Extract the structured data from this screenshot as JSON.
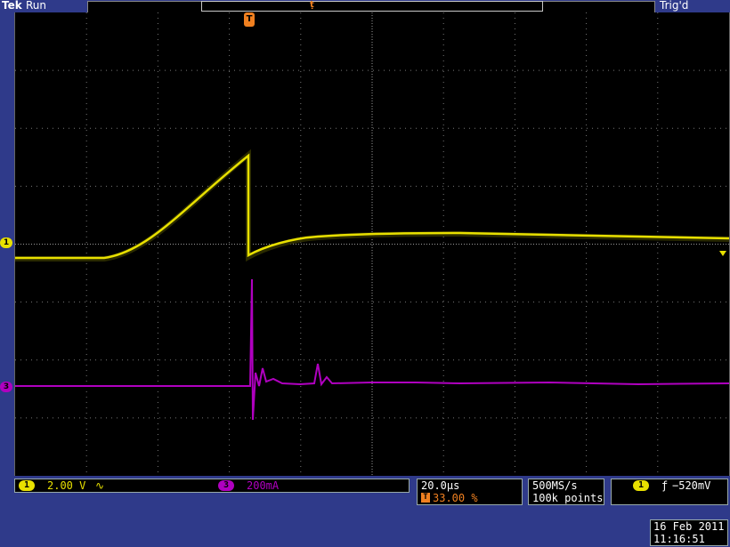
{
  "header": {
    "brand": "Tek",
    "status": "Run",
    "trigger_status": "Trig'd",
    "trigger_marker_label": "T"
  },
  "channels": {
    "ch1": {
      "marker_label": "1",
      "scale": "2.00 V",
      "coupling_symbol": "∿",
      "color": "#e8e000"
    },
    "ch3": {
      "marker_label": "3",
      "scale": "200mA",
      "color": "#b000c0"
    }
  },
  "timebase": {
    "horizontal_scale": "20.0µs",
    "trigger_position": "33.00 %",
    "sample_rate": "500MS/s",
    "record_length": "100k points"
  },
  "trigger": {
    "source_label": "1",
    "slope_symbol": "ƒ",
    "level": "−520mV"
  },
  "date": {
    "date": "16 Feb  2011",
    "time": "11:16:51"
  },
  "colors": {
    "background": "#2f3a8a",
    "screen": "#000000",
    "ch1": "#e8e000",
    "ch3": "#b000c0",
    "grid": "#8a8a8a"
  }
}
